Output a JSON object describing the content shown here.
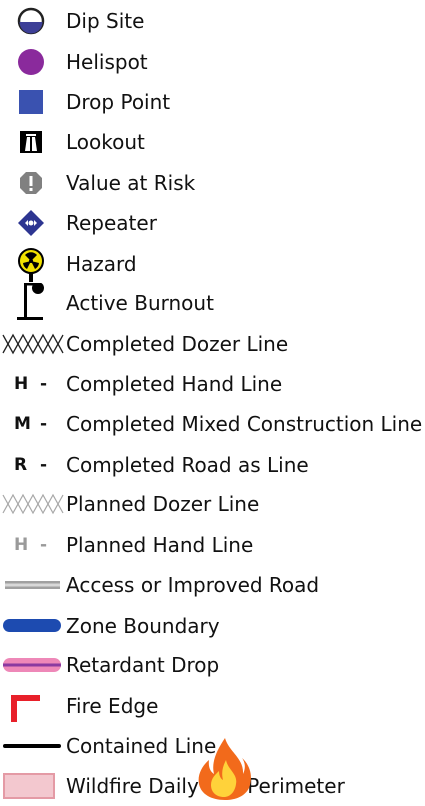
{
  "legend": {
    "items": [
      {
        "label": "Dip Site",
        "icon": "dip-site-icon"
      },
      {
        "label": "Helispot",
        "icon": "helispot-icon"
      },
      {
        "label": "Drop Point",
        "icon": "drop-point-icon"
      },
      {
        "label": "Lookout",
        "icon": "lookout-icon"
      },
      {
        "label": "Value at Risk",
        "icon": "value-at-risk-icon"
      },
      {
        "label": "Repeater",
        "icon": "repeater-icon"
      },
      {
        "label": "Hazard",
        "icon": "hazard-icon"
      },
      {
        "label": "Active Burnout",
        "icon": "active-burnout-icon"
      },
      {
        "label": "Completed Dozer Line",
        "icon": "completed-dozer-line-icon"
      },
      {
        "label": "Completed Hand Line",
        "icon": "completed-hand-line-icon",
        "letter": "H",
        "dash": "-"
      },
      {
        "label": "Completed Mixed Construction Line",
        "icon": "completed-mixed-line-icon",
        "letter": "M",
        "dash": "-"
      },
      {
        "label": "Completed Road as Line",
        "icon": "completed-road-line-icon",
        "letter": "R",
        "dash": "-"
      },
      {
        "label": "Planned Dozer Line",
        "icon": "planned-dozer-line-icon"
      },
      {
        "label": "Planned Hand Line",
        "icon": "planned-hand-line-icon",
        "letter": "H",
        "dash": "-"
      },
      {
        "label": "Access or Improved Road",
        "icon": "access-road-icon"
      },
      {
        "label": "Zone Boundary",
        "icon": "zone-boundary-icon"
      },
      {
        "label": "Retardant Drop",
        "icon": "retardant-drop-icon"
      },
      {
        "label": "Fire Edge",
        "icon": "fire-edge-icon"
      },
      {
        "label": "Contained Line",
        "icon": "contained-line-icon"
      },
      {
        "label": "Wildfire Daily Fire Perimeter",
        "icon": "fire-perimeter-icon"
      }
    ]
  },
  "colors": {
    "dip_site_water": "#3d3f97",
    "helispot": "#8a2a9c",
    "drop_point": "#3a52b0",
    "value_at_risk": "#808080",
    "repeater": "#2d3591",
    "hazard": "#f2e200",
    "zone_boundary": "#1d4bb0",
    "retardant_line": "#8a3aa0",
    "retardant_ends": "#ee88b8",
    "fire_edge": "#e8202a",
    "perimeter_fill": "#f3c8cf",
    "perimeter_stroke": "#e49aa5",
    "flame_outer": "#f26a1b",
    "flame_inner": "#ffd23a"
  }
}
